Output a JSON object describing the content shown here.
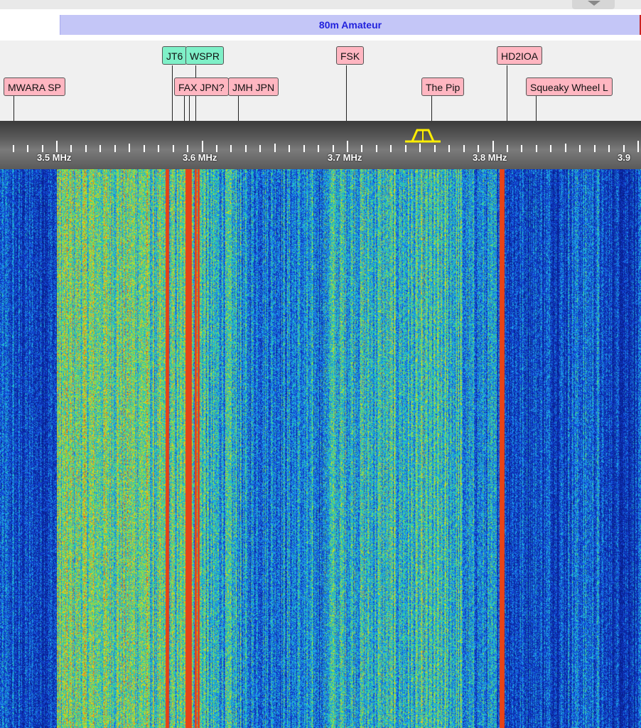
{
  "band": {
    "name": "80m Amateur"
  },
  "stations": [
    {
      "id": "mwara",
      "label": "MWARA SP",
      "color": "pink"
    },
    {
      "id": "jt6",
      "label": "JT6",
      "color": "green"
    },
    {
      "id": "wspr",
      "label": "WSPR",
      "color": "green"
    },
    {
      "id": "fax",
      "label": "FAX JPN?",
      "color": "pink"
    },
    {
      "id": "jmh",
      "label": "JMH JPN",
      "color": "pink"
    },
    {
      "id": "fsk",
      "label": "FSK",
      "color": "pink"
    },
    {
      "id": "pip",
      "label": "The Pip",
      "color": "pink"
    },
    {
      "id": "hd2ioa",
      "label": "HD2IOA",
      "color": "pink"
    },
    {
      "id": "squeaky",
      "label": "Squeaky Wheel L",
      "color": "pink"
    }
  ],
  "scale": {
    "ticks": [
      "3.5 MHz",
      "3.6 MHz",
      "3.7 MHz",
      "3.8 MHz",
      "3.9"
    ]
  },
  "colors": {
    "label_pink": "#ffb6c1",
    "label_green": "#7ff0c8",
    "band_bar": "#c4c6f7",
    "band_text": "#2222dd",
    "passband": "#ffee00"
  }
}
